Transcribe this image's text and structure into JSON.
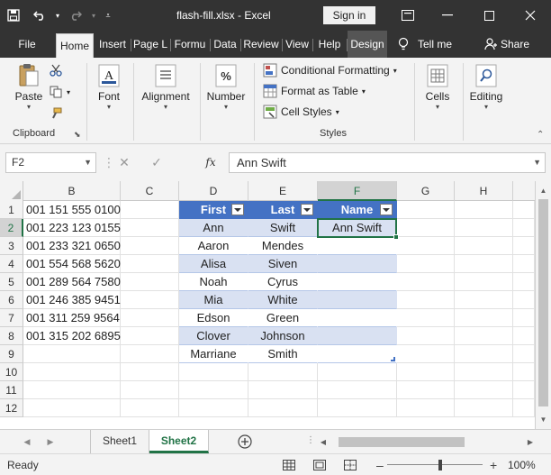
{
  "titlebar": {
    "title": "flash-fill.xlsx  -  Excel",
    "signin_label": "Sign in"
  },
  "ribbon_tabs": [
    "File",
    "Home",
    "Insert",
    "Page L",
    "Formu",
    "Data",
    "Review",
    "View",
    "Help",
    "Design"
  ],
  "tell_me": "Tell me",
  "share": "Share",
  "ribbon": {
    "clipboard": {
      "label": "Clipboard",
      "paste": "Paste"
    },
    "font": "Font",
    "alignment": "Alignment",
    "number": "Number",
    "styles": {
      "label": "Styles",
      "conditional": "Conditional Formatting",
      "format_table": "Format as Table",
      "cell_styles": "Cell Styles"
    },
    "cells": "Cells",
    "editing": "Editing"
  },
  "formula_bar": {
    "name_box": "F2",
    "content": "Ann Swift"
  },
  "columns": [
    "B",
    "C",
    "D",
    "E",
    "F",
    "G",
    "H"
  ],
  "rows": [
    "1",
    "2",
    "3",
    "4",
    "5",
    "6",
    "7",
    "8",
    "9",
    "10",
    "11",
    "12"
  ],
  "column_b": [
    "001 151 555 0100",
    "001 223 123 0155",
    "001 233 321 0650",
    "001 554 568 5620",
    "001 289 564 7580",
    "001 246 385 9451",
    "001 311 259 9564",
    "001 315 202 6895"
  ],
  "table": {
    "headers": [
      "First",
      "Last",
      "Name"
    ],
    "rows": [
      [
        "Ann",
        "Swift",
        "Ann Swift"
      ],
      [
        "Aaron",
        "Mendes",
        ""
      ],
      [
        "Alisa",
        "Siven",
        ""
      ],
      [
        "Noah",
        "Cyrus",
        ""
      ],
      [
        "Mia",
        "White",
        ""
      ],
      [
        "Edson",
        "Green",
        ""
      ],
      [
        "Clover",
        "Johnson",
        ""
      ],
      [
        "Marriane",
        "Smith",
        ""
      ]
    ]
  },
  "sheets": [
    "Sheet1",
    "Sheet2"
  ],
  "active_sheet": "Sheet2",
  "status": {
    "ready": "Ready",
    "zoom": "100%"
  },
  "colors": {
    "accent": "#217346",
    "table_header": "#4472c4",
    "table_band": "#d9e1f2"
  }
}
